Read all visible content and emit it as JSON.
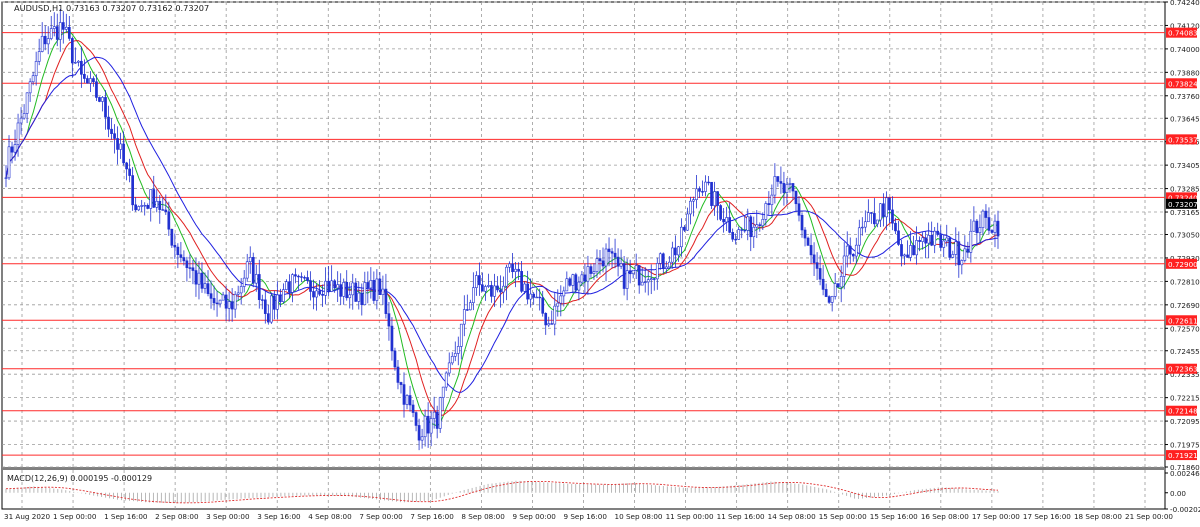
{
  "chart_data": [
    {
      "type": "line",
      "subtype": "candlestick-with-moving-averages",
      "title": "AUDUSD,H1  0.73163 0.73207 0.73162 0.73207",
      "symbol_label": "AUDUSD,H1",
      "ohlc_label": "0.73163 0.73207 0.73162 0.73207",
      "ylim": [
        0.7186,
        0.7424
      ],
      "y_ticks": [
        "0.74240",
        "0.74120",
        "0.74000",
        "0.73880",
        "0.73760",
        "0.73645",
        "0.73525",
        "0.73405",
        "0.73285",
        "0.73165",
        "0.73050",
        "0.72930",
        "0.72810",
        "0.72690",
        "0.72570",
        "0.72455",
        "0.72335",
        "0.72215",
        "0.72095",
        "0.71975",
        "0.71860"
      ],
      "x_tick_labels": [
        "31 Aug 2020",
        "1 Sep 00:00",
        "1 Sep 16:00",
        "2 Sep 08:00",
        "3 Sep 00:00",
        "3 Sep 16:00",
        "4 Sep 08:00",
        "7 Sep 00:00",
        "7 Sep 16:00",
        "8 Sep 08:00",
        "9 Sep 00:00",
        "9 Sep 16:00",
        "10 Sep 08:00",
        "11 Sep 00:00",
        "11 Sep 16:00",
        "14 Sep 08:00",
        "15 Sep 00:00",
        "15 Sep 16:00",
        "16 Sep 08:00",
        "17 Sep 00:00",
        "17 Sep 16:00",
        "18 Sep 08:00",
        "21 Sep 00:00"
      ],
      "horizontal_levels": [
        "0.74083",
        "0.73824",
        "0.73537",
        "0.73240",
        "0.72900",
        "0.72611",
        "0.72363",
        "0.72148",
        "0.71921"
      ],
      "current_price": "0.73207",
      "price_series_anchors": [
        0.734,
        0.737,
        0.7405,
        0.7412,
        0.7385,
        0.7375,
        0.735,
        0.7318,
        0.7325,
        0.73,
        0.7285,
        0.727,
        0.7268,
        0.729,
        0.7265,
        0.728,
        0.7278,
        0.728,
        0.7276,
        0.7275,
        0.7278,
        0.723,
        0.7205,
        0.721,
        0.7245,
        0.728,
        0.7275,
        0.7285,
        0.7275,
        0.726,
        0.728,
        0.7285,
        0.7295,
        0.7283,
        0.7285,
        0.729,
        0.73,
        0.7333,
        0.732,
        0.7305,
        0.731,
        0.733,
        0.7325,
        0.7295,
        0.7265,
        0.7295,
        0.731,
        0.732,
        0.729,
        0.7305,
        0.73,
        0.7295,
        0.7312,
        0.731
      ],
      "series": [
        {
          "name": "AUDUSD,H1",
          "color": "#2030d0"
        },
        {
          "color": "#22bb22"
        },
        {
          "color": "#e02020"
        },
        {
          "color": "#2020e0"
        }
      ]
    },
    {
      "type": "bar",
      "title": "MACD(12,26,9) 0.000195 -0.000129",
      "name_label": "MACD(12,26,9)",
      "values_label": "0.000195 -0.000129",
      "ylim": [
        -0.002023,
        0.002461
      ],
      "y_ticks": [
        "0.002461",
        "0.00",
        "-0.002023"
      ],
      "macd_anchors": [
        0.0005,
        0.0008,
        0.0004,
        -0.0003,
        -0.0009,
        -0.0012,
        -0.0013,
        -0.0011,
        -0.0008,
        -0.0006,
        -0.0004,
        -0.0003,
        -0.0004,
        -0.0008,
        -0.0012,
        -0.001,
        0.0002,
        0.0011,
        0.0015,
        0.0013,
        0.0011,
        0.001,
        0.0012,
        0.0009,
        0.0006,
        0.0007,
        0.001,
        0.0014,
        0.0011,
        0.0004,
        -0.0008,
        -0.0004,
        0.0003,
        0.0007,
        0.0004,
        0.0002
      ],
      "signal_color": "#e03030",
      "histogram_color": "#b0b0b0"
    }
  ],
  "colors": {
    "background": "#ffffff",
    "grid": "#9a9a9a",
    "levels": "#ff2a2a",
    "label_bg": "#ff2020",
    "current_bg": "#000000",
    "axis_text": "#202020"
  }
}
